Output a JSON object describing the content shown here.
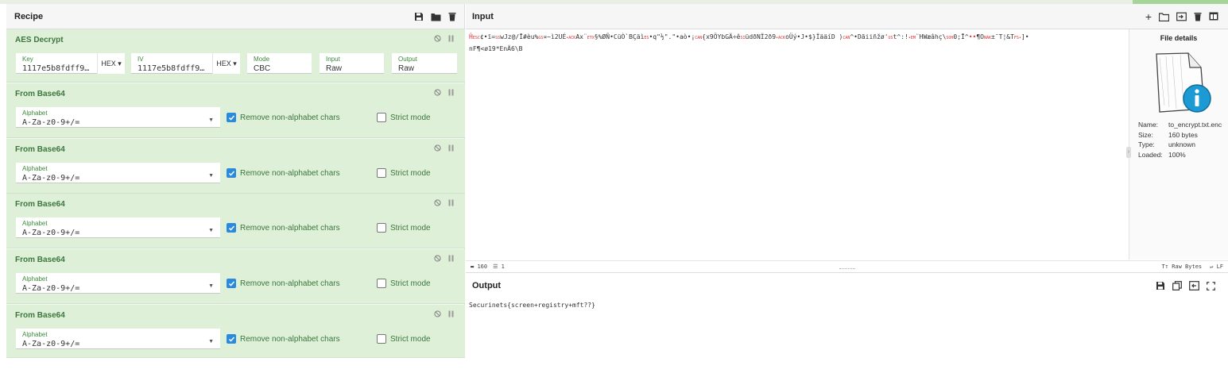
{
  "recipe": {
    "title": "Recipe",
    "aes": {
      "title": "AES Decrypt",
      "key_label": "Key",
      "key_value": "1117e5b8fdff9…",
      "key_format": "HEX ▾",
      "iv_label": "IV",
      "iv_value": "1117e5b8fdff9…",
      "iv_format": "HEX ▾",
      "mode_label": "Mode",
      "mode_value": "CBC",
      "input_label": "Input",
      "input_value": "Raw",
      "output_label": "Output",
      "output_value": "Raw"
    },
    "from_base64": [
      {
        "title": "From Base64",
        "alphabet_label": "Alphabet",
        "alphabet_value": "A-Za-z0-9+/=",
        "remove_label": "Remove non-alphabet chars",
        "strict_label": "Strict mode"
      },
      {
        "title": "From Base64",
        "alphabet_label": "Alphabet",
        "alphabet_value": "A-Za-z0-9+/=",
        "remove_label": "Remove non-alphabet chars",
        "strict_label": "Strict mode"
      },
      {
        "title": "From Base64",
        "alphabet_label": "Alphabet",
        "alphabet_value": "A-Za-z0-9+/=",
        "remove_label": "Remove non-alphabet chars",
        "strict_label": "Strict mode"
      },
      {
        "title": "From Base64",
        "alphabet_label": "Alphabet",
        "alphabet_value": "A-Za-z0-9+/=",
        "remove_label": "Remove non-alphabet chars",
        "strict_label": "Strict mode"
      },
      {
        "title": "From Base64",
        "alphabet_label": "Alphabet",
        "alphabet_value": "A-Za-z0-9+/=",
        "remove_label": "Remove non-alphabet chars",
        "strict_label": "Strict mode"
      }
    ]
  },
  "input": {
    "title": "Input",
    "line1_a": "Ĥ",
    "line1_b": "¢•ï=",
    "line1_c": "wJz@/Ī#èu%",
    "line1_d": "¤~ì2UÉ",
    "line1_e": "Ax¨",
    "line1_f": "§%ØÑ•CüÒ`BÇäì",
    "line1_g": "•q\"½\".\"",
    "line1_h": "•aò•¡",
    "line1_i": "{x9ÖYbGÄ÷ê",
    "line1_j": "üdðNÏ2ð9",
    "line1_k": "oÜý•J•$}ÏääíD )",
    "line1_l": "^•Dãiiñž",
    "line1_m": "ø'",
    "line1_n": "t^:!",
    "line1_o": "¨HWæâhç\\",
    "line1_p": "0;Ī^",
    "line1_q": "¶O",
    "line1_r": "±¯T¦&T",
    "line1_s": "]•",
    "line2": "nF¶<ø19*EnÄ6\\B",
    "status_chars": "160",
    "status_lines": "1",
    "status_raw": "Raw Bytes",
    "status_eol": "LF"
  },
  "file_details": {
    "title": "File details",
    "name_label": "Name:",
    "name_value": "to_encrypt.txt.enc",
    "size_label": "Size:",
    "size_value": "160 bytes",
    "type_label": "Type:",
    "type_value": "unknown",
    "loaded_label": "Loaded:",
    "loaded_value": "100%"
  },
  "output": {
    "title": "Output",
    "text": "Securinets{screen+registry+mft??}"
  }
}
